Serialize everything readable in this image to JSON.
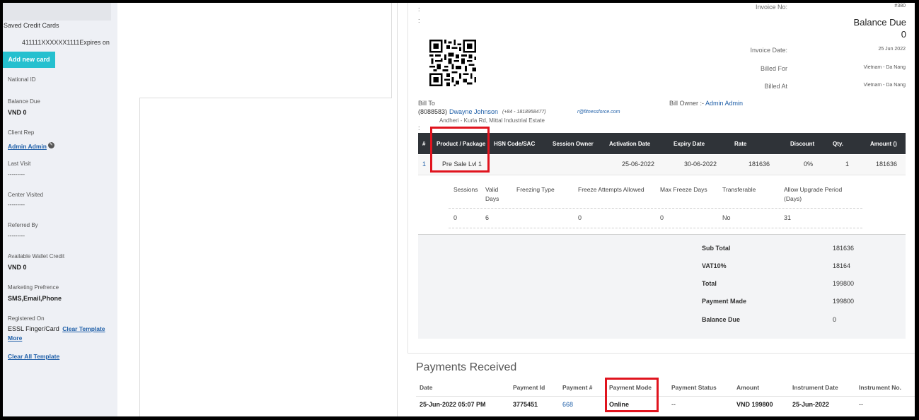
{
  "sidebar": {
    "saved_cards_label": "Saved Credit Cards",
    "card_number": "411111XXXXXX1111Expires on",
    "add_card_label": "Add new card",
    "national_id_label": "National ID",
    "balance_due_label": "Balance Due",
    "balance_due_value": "VND 0",
    "client_rep_label": "Client Rep",
    "client_rep_value": "Admin Admin",
    "last_visit_label": "Last Visit",
    "last_visit_value": "---------",
    "center_visited_label": "Center Visited",
    "center_visited_value": "---------",
    "referred_by_label": "Referred By",
    "referred_by_value": "---------",
    "wallet_label": "Available Wallet Credit",
    "wallet_value": "VND 0",
    "marketing_label": "Marketing Prefrence",
    "marketing_value": "SMS,Email,Phone",
    "registered_label": "Registered On",
    "registered_value": "ESSL Finger/Card",
    "clear_template": "Clear Template",
    "more": "More",
    "clear_all_template": "Clear All Template"
  },
  "invoice": {
    "invoice_no_label": "Invoice No:",
    "invoice_no_value": "#380",
    "balance_due_title": "Balance Due",
    "balance_due_amount": "0",
    "invoice_date_label": "Invoice Date:",
    "invoice_date_value": "25 Jun 2022",
    "billed_for_label": "Billed For",
    "billed_for_value": "Vietnam - Da Nang",
    "billed_at_label": "Billed At",
    "billed_at_value": "Vietnam - Da Nang",
    "bill_to_label": "Bill To",
    "bill_to_code": "(8088583)",
    "bill_to_name": "Dwayne Johnson",
    "bill_to_phone": "(+84 - 1818958477)",
    "bill_to_email": "r@fitnessforce.com",
    "bill_to_address": "Andheri - Kurla Rd, Mittal Industrial Estate",
    "bill_owner_label": "Bill Owner :-",
    "bill_owner_name": "Admin Admin",
    "colon": ":"
  },
  "table": {
    "headers": [
      "#",
      "Product / Package",
      "HSN Code/SAC",
      "Session Owner",
      "Activation Date",
      "Expiry Date",
      "Rate",
      "Discount",
      "Qty.",
      "Amount ()"
    ],
    "row": {
      "index": "1",
      "product": "Pre Sale Lvl 1",
      "activation": "25-06-2022",
      "expiry": "30-06-2022",
      "rate": "181636",
      "discount": "0%",
      "qty": "1",
      "amount": "181636"
    }
  },
  "subtable": {
    "headers": {
      "sessions": "Sessions",
      "valid_days_1": "Valid",
      "valid_days_2": "Days",
      "freezing_type": "Freezing Type",
      "freeze_attempts": "Freeze Attempts Allowed",
      "max_freeze": "Max Freeze Days",
      "transferable": "Transferable",
      "upgrade_1": "Allow Upgrade Period",
      "upgrade_2": "(Days)"
    },
    "row": {
      "sessions": "0",
      "valid_days": "6",
      "freeze_attempts": "0",
      "max_freeze": "0",
      "transferable": "No",
      "upgrade": "31"
    }
  },
  "totals": [
    {
      "label": "Sub Total",
      "value": "181636"
    },
    {
      "label": "VAT10%",
      "value": "18164"
    },
    {
      "label": "Total",
      "value": "199800"
    },
    {
      "label": "Payment Made",
      "value": "199800"
    },
    {
      "label": "Balance Due",
      "value": "0"
    }
  ],
  "payments": {
    "title": "Payments Received",
    "headers": [
      "Date",
      "Payment Id",
      "Payment #",
      "Payment Mode",
      "Payment Status",
      "Amount",
      "Instrument Date",
      "Instrument No."
    ],
    "row": {
      "date": "25-Jun-2022 05:07 PM",
      "payment_id": "3775451",
      "payment_no": "668",
      "mode": "Online",
      "status": "--",
      "amount": "VND 199800",
      "instrument_date": "25-Jun-2022",
      "instrument_no": "--"
    }
  },
  "colors": {
    "accent": "#25c0cf",
    "highlight": "#e0141e",
    "table_header": "#2f3338",
    "link": "#1f5fa8"
  }
}
